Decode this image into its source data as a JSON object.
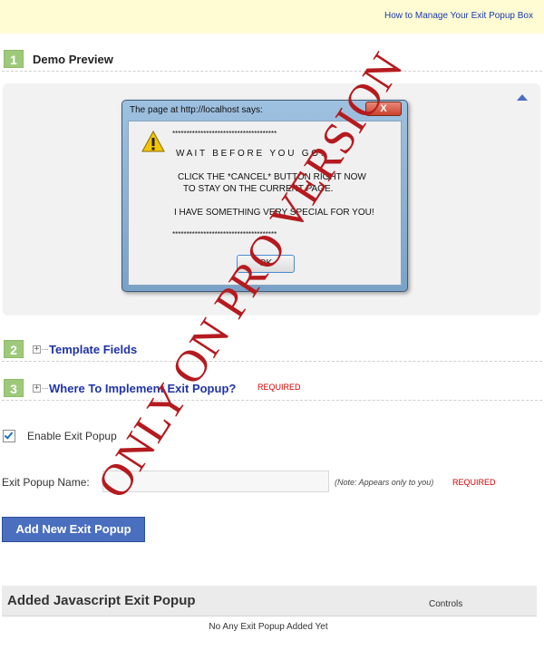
{
  "topbar": {
    "help_link": "How to Manage Your Exit Popup Box"
  },
  "steps": [
    {
      "number": "1",
      "title": "Demo Preview"
    },
    {
      "number": "2",
      "title": "Template Fields"
    },
    {
      "number": "3",
      "title": "Where To Implement Exit Popup?",
      "required": "REQUIRED"
    }
  ],
  "dialog": {
    "title": "The page at http://localhost says:",
    "close": "X",
    "lines": [
      "*************************************",
      "W A I T   B E F O R E   Y O U   G O !",
      "CLICK THE *CANCEL* BUTTON RIGHT NOW",
      "TO STAY ON THE CURRENT PAGE.",
      "I HAVE SOMETHING VERY SPECIAL FOR YOU!",
      "*************************************"
    ],
    "ok": "OK"
  },
  "watermark": "ONLY ON PRO VERSION",
  "form": {
    "enable_label": "Enable Exit Popup",
    "enable_checked": true,
    "name_label": "Exit Popup Name:",
    "name_value": "",
    "note": "(Note: Appears only to you)",
    "note_required": "REQUIRED",
    "add_button": "Add New Exit Popup"
  },
  "added": {
    "title": "Added Javascript Exit Popup",
    "controls": "Controls",
    "empty": "No Any Exit Popup Added Yet"
  },
  "colors": {
    "accent": "#4a6fbf",
    "step_badge": "#9ec97b",
    "watermark": "#b51a1e",
    "required": "#d40000"
  },
  "icons": {
    "warning": "warning-icon",
    "expand": "plus-box-icon",
    "collapse": "chevron-up-icon",
    "check": "check-icon"
  }
}
